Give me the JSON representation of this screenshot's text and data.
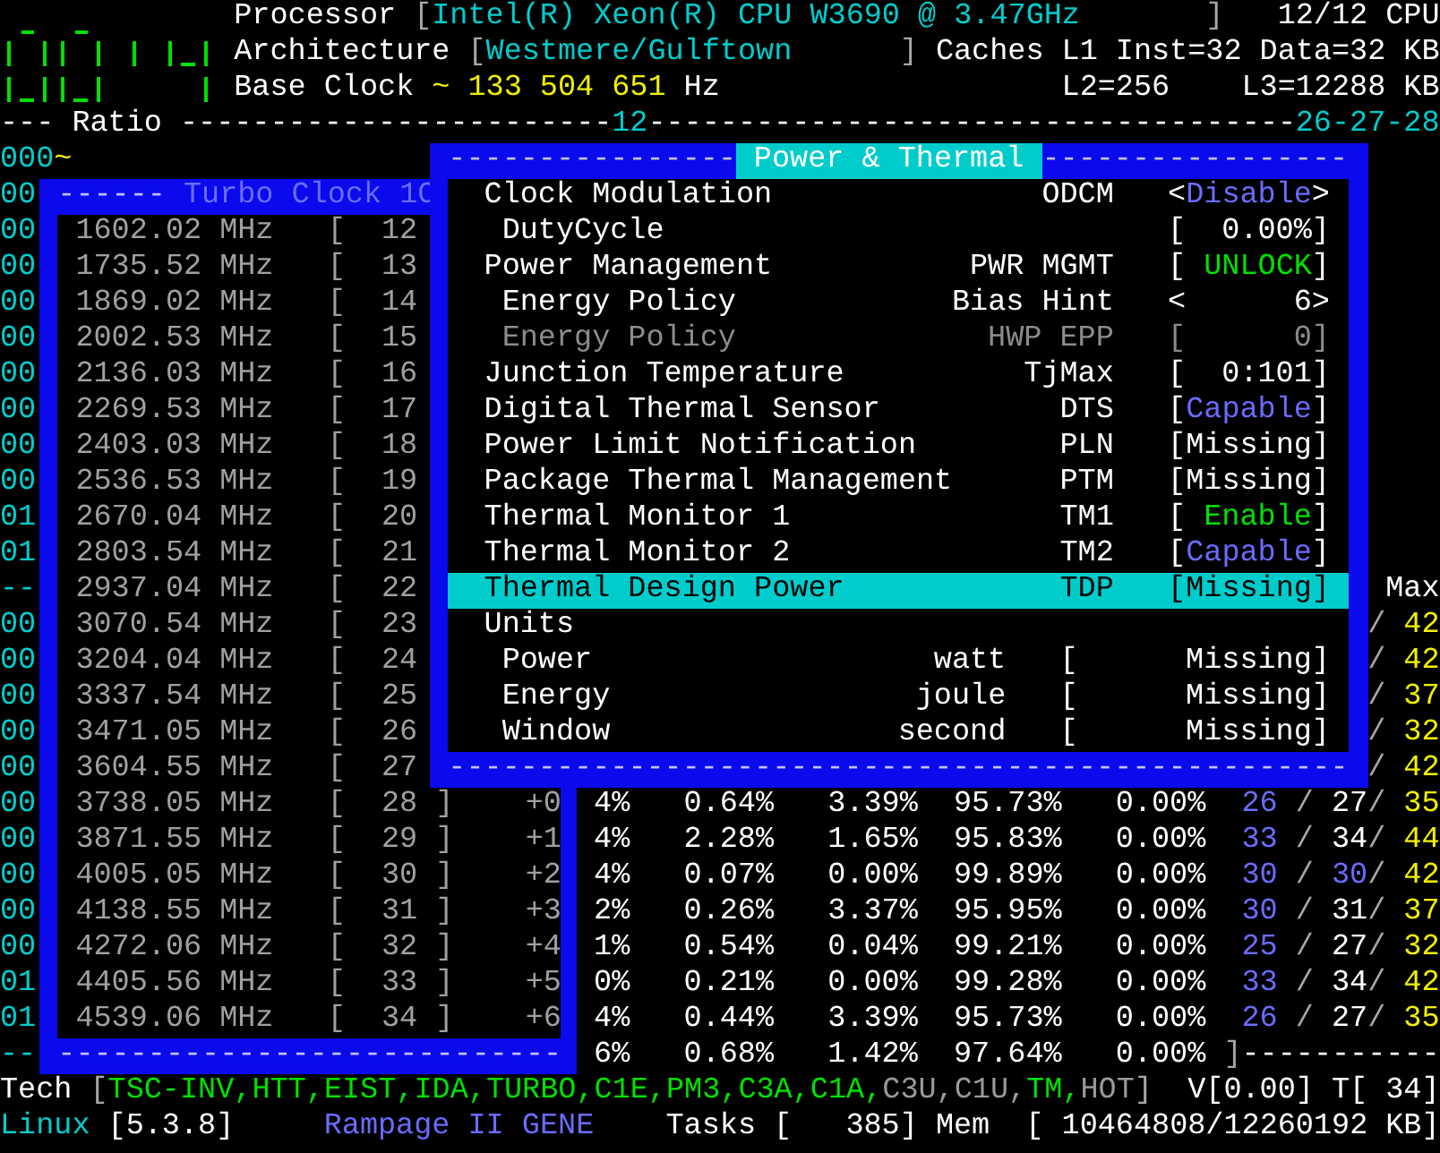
{
  "header": {
    "processor": {
      "label": "Processor",
      "open": "[",
      "value": "Intel(R) Xeon(R) CPU W3690 @ 3.47GHz",
      "close": "]",
      "count": "12/12",
      "unit": "CPU"
    },
    "architecture": {
      "label": "Architecture",
      "open": "[",
      "value": "Westmere/Gulftown",
      "close": "]",
      "caches_label": "Caches",
      "l1_label": "L1",
      "l1_inst": "Inst=32",
      "l1_data": "Data=32",
      "l1_unit": "KB"
    },
    "base_clock": {
      "label": "Base Clock",
      "marker": "~",
      "value": "133 504 651",
      "unit": "Hz",
      "l2": "L2=256",
      "l3": "L3=12288",
      "l3_unit": "KB"
    },
    "ratio_bar": {
      "lead": "---",
      "label": "Ratio",
      "rule_a": "------------------------",
      "mark": "12",
      "rule_b": "------------------------------------",
      "ratios": "26-27-28"
    },
    "cpu_marker": {
      "id": "000",
      "marker": "~"
    }
  },
  "cpu_ids": [
    "00",
    "00",
    "00",
    "00",
    "00",
    "00",
    "00",
    "00",
    "00",
    "01",
    "01",
    "--",
    "00",
    "00",
    "00",
    "00",
    "00",
    "00",
    "00",
    "00",
    "00",
    "00",
    "01",
    "01",
    "--"
  ],
  "max_column": {
    "heading": "Max",
    "rows": [
      {
        "slash": "/",
        "value": "42"
      },
      {
        "slash": "/",
        "value": "42"
      },
      {
        "slash": "/",
        "value": "37"
      },
      {
        "slash": "/",
        "value": "32"
      },
      {
        "slash": "/",
        "value": "42"
      }
    ]
  },
  "core_stats": [
    {
      "cells": [
        "4%",
        "0.64%",
        "3.39%",
        "95.73%",
        "0.00%"
      ],
      "min": {
        "text": "26",
        "color": "#6b6bff"
      },
      "sep1": "/",
      "cur": {
        "text": "27",
        "color": "#ffffff"
      },
      "sep2": "/",
      "max": {
        "text": "35",
        "color": "#f0f000"
      }
    },
    {
      "cells": [
        "4%",
        "2.28%",
        "1.65%",
        "95.83%",
        "0.00%"
      ],
      "min": {
        "text": "33",
        "color": "#6b6bff"
      },
      "sep1": "/",
      "cur": {
        "text": "34",
        "color": "#ffffff"
      },
      "sep2": "/",
      "max": {
        "text": "44",
        "color": "#f0f000"
      }
    },
    {
      "cells": [
        "4%",
        "0.07%",
        "0.00%",
        "99.89%",
        "0.00%"
      ],
      "min": {
        "text": "30",
        "color": "#6b6bff"
      },
      "sep1": "/",
      "cur": {
        "text": "30",
        "color": "#6b6bff"
      },
      "sep2": "/",
      "max": {
        "text": "42",
        "color": "#f0f000"
      }
    },
    {
      "cells": [
        "2%",
        "0.26%",
        "3.37%",
        "95.95%",
        "0.00%"
      ],
      "min": {
        "text": "30",
        "color": "#6b6bff"
      },
      "sep1": "/",
      "cur": {
        "text": "31",
        "color": "#ffffff"
      },
      "sep2": "/",
      "max": {
        "text": "37",
        "color": "#f0f000"
      }
    },
    {
      "cells": [
        "1%",
        "0.54%",
        "0.04%",
        "99.21%",
        "0.00%"
      ],
      "min": {
        "text": "25",
        "color": "#6b6bff"
      },
      "sep1": "/",
      "cur": {
        "text": "27",
        "color": "#ffffff"
      },
      "sep2": "/",
      "max": {
        "text": "32",
        "color": "#f0f000"
      }
    },
    {
      "cells": [
        "0%",
        "0.21%",
        "0.00%",
        "99.28%",
        "0.00%"
      ],
      "min": {
        "text": "33",
        "color": "#6b6bff"
      },
      "sep1": "/",
      "cur": {
        "text": "34",
        "color": "#ffffff"
      },
      "sep2": "/",
      "max": {
        "text": "42",
        "color": "#f0f000"
      }
    },
    {
      "cells": [
        "4%",
        "0.44%",
        "3.39%",
        "95.73%",
        "0.00%"
      ],
      "min": {
        "text": "26",
        "color": "#6b6bff"
      },
      "sep1": "/",
      "cur": {
        "text": "27",
        "color": "#ffffff"
      },
      "sep2": "/",
      "max": {
        "text": "35",
        "color": "#f0f000"
      }
    }
  ],
  "average": {
    "cells": [
      "6%",
      "0.68%",
      "1.42%",
      "97.64%",
      "0.00%"
    ],
    "close": "]",
    "rule": "-----------"
  },
  "tech": {
    "label": "Tech",
    "open": "[",
    "close": "]",
    "flags": [
      {
        "name": "TSC-INV",
        "sep": ",",
        "on": true
      },
      {
        "name": "HTT",
        "sep": ",",
        "on": true
      },
      {
        "name": "EIST",
        "sep": ",",
        "on": true
      },
      {
        "name": "IDA",
        "sep": ",",
        "on": true
      },
      {
        "name": "TURBO",
        "sep": ",",
        "on": true
      },
      {
        "name": "C1E",
        "sep": ",",
        "on": true
      },
      {
        "name": "PM3",
        "sep": ",",
        "on": true
      },
      {
        "name": "C3A",
        "sep": ",",
        "on": true
      },
      {
        "name": "C1A",
        "sep": ",",
        "on": true
      },
      {
        "name": "C3U",
        "sep": ",",
        "on": false
      },
      {
        "name": "C1U",
        "sep": ",",
        "on": false
      },
      {
        "name": "TM",
        "sep": ",",
        "on": true
      },
      {
        "name": "HOT",
        "on": false
      }
    ],
    "voltage": "V[0.00]",
    "temperature": "T[ 34]"
  },
  "status": {
    "os": "Linux",
    "kernel": "[5.3.8]",
    "board": "Rampage II GENE",
    "tasks_label": "Tasks",
    "tasks_open": "[",
    "tasks": "385",
    "tasks_close": "]",
    "mem_label": "Mem",
    "mem_open": "[",
    "mem": "10464808/12260192",
    "mem_unit": "KB",
    "mem_close": "]"
  },
  "turbo": {
    "title_rule": "------",
    "title": "Turbo Clock 1C",
    "bottom_rule": "----------------------------",
    "rows": [
      {
        "frequency": "1602.02",
        "unit": "MHz",
        "open": "[",
        "ratio": "12"
      },
      {
        "frequency": "1735.52",
        "unit": "MHz",
        "open": "[",
        "ratio": "13"
      },
      {
        "frequency": "1869.02",
        "unit": "MHz",
        "open": "[",
        "ratio": "14"
      },
      {
        "frequency": "2002.53",
        "unit": "MHz",
        "open": "[",
        "ratio": "15"
      },
      {
        "frequency": "2136.03",
        "unit": "MHz",
        "open": "[",
        "ratio": "16"
      },
      {
        "frequency": "2269.53",
        "unit": "MHz",
        "open": "[",
        "ratio": "17"
      },
      {
        "frequency": "2403.03",
        "unit": "MHz",
        "open": "[",
        "ratio": "18"
      },
      {
        "frequency": "2536.53",
        "unit": "MHz",
        "open": "[",
        "ratio": "19"
      },
      {
        "frequency": "2670.04",
        "unit": "MHz",
        "open": "[",
        "ratio": "20"
      },
      {
        "frequency": "2803.54",
        "unit": "MHz",
        "open": "[",
        "ratio": "21"
      },
      {
        "frequency": "2937.04",
        "unit": "MHz",
        "open": "[",
        "ratio": "22"
      },
      {
        "frequency": "3070.54",
        "unit": "MHz",
        "open": "[",
        "ratio": "23"
      },
      {
        "frequency": "3204.04",
        "unit": "MHz",
        "open": "[",
        "ratio": "24"
      },
      {
        "frequency": "3337.54",
        "unit": "MHz",
        "open": "[",
        "ratio": "25"
      },
      {
        "frequency": "3471.05",
        "unit": "MHz",
        "open": "[",
        "ratio": "26"
      },
      {
        "frequency": "3604.55",
        "unit": "MHz",
        "open": "[",
        "ratio": "27"
      },
      {
        "frequency": "3738.05",
        "unit": "MHz",
        "open": "[",
        "ratio": "28",
        "close": "]",
        "offset": "+0"
      },
      {
        "frequency": "3871.55",
        "unit": "MHz",
        "open": "[",
        "ratio": "29",
        "close": "]",
        "offset": "+1"
      },
      {
        "frequency": "4005.05",
        "unit": "MHz",
        "open": "[",
        "ratio": "30",
        "close": "]",
        "offset": "+2"
      },
      {
        "frequency": "4138.55",
        "unit": "MHz",
        "open": "[",
        "ratio": "31",
        "close": "]",
        "offset": "+3"
      },
      {
        "frequency": "4272.06",
        "unit": "MHz",
        "open": "[",
        "ratio": "32",
        "close": "]",
        "offset": "+4"
      },
      {
        "frequency": "4405.56",
        "unit": "MHz",
        "open": "[",
        "ratio": "33",
        "close": "]",
        "offset": "+5"
      },
      {
        "frequency": "4539.06",
        "unit": "MHz",
        "open": "[",
        "ratio": "34",
        "close": "]",
        "offset": "+6"
      }
    ]
  },
  "power": {
    "title": "Power & Thermal",
    "rule_left": "----------------",
    "rule_right": "-----------------",
    "bottom_rule": "--------------------------------------------------",
    "items": [
      {
        "kind": "setting",
        "label": "Clock Modulation",
        "code": "ODCM",
        "value": {
          "open": "<",
          "text": "Disable",
          "close": ">",
          "color": "#6b6bff"
        },
        "selected": false,
        "disabled": false,
        "children": [
          {
            "kind": "setting",
            "label": "DutyCycle",
            "value": {
              "open": "[",
              "text": "0.00%",
              "close": "]"
            },
            "selected": false,
            "disabled": false
          }
        ]
      },
      {
        "kind": "setting",
        "label": "Power Management",
        "code": "PWR MGMT",
        "value": {
          "open": "[",
          "text": "UNLOCK",
          "close": "]",
          "color": "#00e000"
        },
        "selected": false,
        "disabled": false,
        "children": [
          {
            "kind": "setting",
            "label": "Energy Policy",
            "code": "Bias Hint",
            "value": {
              "open": "<",
              "text": "6",
              "close": ">"
            },
            "selected": false,
            "disabled": false
          },
          {
            "kind": "setting",
            "label": "Energy Policy",
            "code": "HWP EPP",
            "value": {
              "open": "[",
              "text": "0",
              "close": "]"
            },
            "selected": false,
            "disabled": true
          }
        ]
      },
      {
        "kind": "setting",
        "label": "Junction Temperature",
        "code": "TjMax",
        "value": {
          "open": "[",
          "text": "0:101",
          "close": "]"
        },
        "selected": false,
        "disabled": false
      },
      {
        "kind": "setting",
        "label": "Digital Thermal Sensor",
        "code": "DTS",
        "value": {
          "open": "[",
          "text": "Capable",
          "close": "]",
          "color": "#6b6bff"
        },
        "selected": false,
        "disabled": false
      },
      {
        "kind": "setting",
        "label": "Power Limit Notification",
        "code": "PLN",
        "value": {
          "open": "[",
          "text": "Missing",
          "close": "]"
        },
        "selected": false,
        "disabled": false
      },
      {
        "kind": "setting",
        "label": "Package Thermal Management",
        "code": "PTM",
        "value": {
          "open": "[",
          "text": "Missing",
          "close": "]"
        },
        "selected": false,
        "disabled": false
      },
      {
        "kind": "setting",
        "label": "Thermal Monitor 1",
        "code": "TM1",
        "value": {
          "open": "[",
          "text": "Enable",
          "close": "]",
          "color": "#00e000"
        },
        "selected": false,
        "disabled": false
      },
      {
        "kind": "setting",
        "label": "Thermal Monitor 2",
        "code": "TM2",
        "value": {
          "open": "[",
          "text": "Capable",
          "close": "]",
          "color": "#6b6bff"
        },
        "selected": false,
        "disabled": false
      },
      {
        "kind": "setting",
        "label": "Thermal Design Power",
        "code": "TDP",
        "value": {
          "open": "[",
          "text": "Missing",
          "close": "]"
        },
        "selected": true,
        "disabled": false
      },
      {
        "kind": "group",
        "label": "Units",
        "selected": false,
        "disabled": false,
        "children": [
          {
            "kind": "unit",
            "label": "Power",
            "code": "watt",
            "value": {
              "open": "[",
              "text": "Missing",
              "close": "]"
            },
            "selected": false,
            "disabled": false
          },
          {
            "kind": "unit",
            "label": "Energy",
            "code": "joule",
            "value": {
              "open": "[",
              "text": "Missing",
              "close": "]"
            },
            "selected": false,
            "disabled": false
          },
          {
            "kind": "unit",
            "label": "Window",
            "code": "second",
            "value": {
              "open": "[",
              "text": "Missing",
              "close": "]"
            },
            "selected": false,
            "disabled": false
          }
        ]
      }
    ]
  }
}
